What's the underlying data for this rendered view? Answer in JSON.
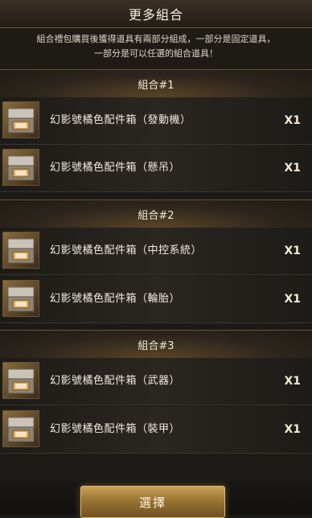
{
  "header": {
    "title": "更多組合"
  },
  "description": {
    "line1": "組合禮包購買後獲得道具有兩部分組成，一部分是固定道具，",
    "line2": "一部分是可以任選的組合道具！"
  },
  "groups": [
    {
      "label": "組合#1",
      "items": [
        {
          "name": "幻影號橘色配件箱（發動機）",
          "qty": "X1",
          "icon": "crate-icon"
        },
        {
          "name": "幻影號橘色配件箱（懸吊）",
          "qty": "X1",
          "icon": "crate-icon"
        }
      ]
    },
    {
      "label": "組合#2",
      "items": [
        {
          "name": "幻影號橘色配件箱（中控系統）",
          "qty": "X1",
          "icon": "crate-icon"
        },
        {
          "name": "幻影號橘色配件箱（輪胎）",
          "qty": "X1",
          "icon": "crate-icon"
        }
      ]
    },
    {
      "label": "組合#3",
      "items": [
        {
          "name": "幻影號橘色配件箱（武器）",
          "qty": "X1",
          "icon": "crate-icon"
        },
        {
          "name": "幻影號橘色配件箱（裝甲）",
          "qty": "X1",
          "icon": "crate-icon"
        }
      ]
    }
  ],
  "footer": {
    "select_label": "選擇"
  }
}
